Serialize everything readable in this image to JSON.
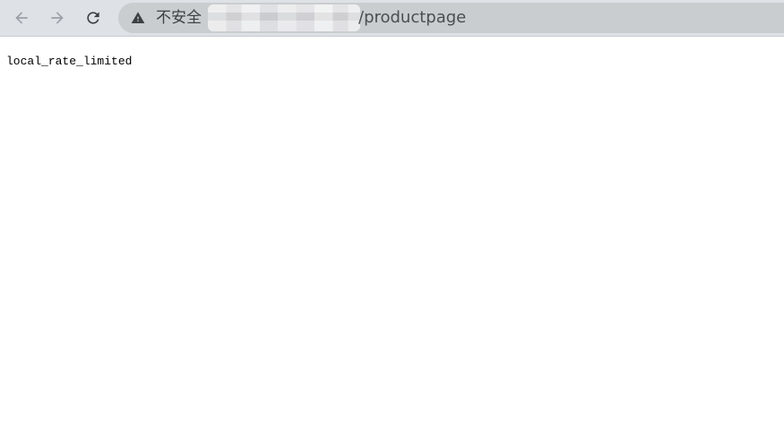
{
  "toolbar": {
    "back_icon": "arrow-left-icon",
    "forward_icon": "arrow-right-icon",
    "reload_icon": "reload-icon"
  },
  "omnibox": {
    "security_icon": "warning-triangle-icon",
    "security_label": "不安全",
    "url_path": "/productpage"
  },
  "page": {
    "body_text": "local_rate_limited"
  },
  "colors": {
    "toolbar_bg": "#dee1e6",
    "omnibox_bg": "#c9cdcf",
    "icon_disabled": "#9aa0a6",
    "icon_active": "#3c4043",
    "page_bg": "#ffffff"
  }
}
